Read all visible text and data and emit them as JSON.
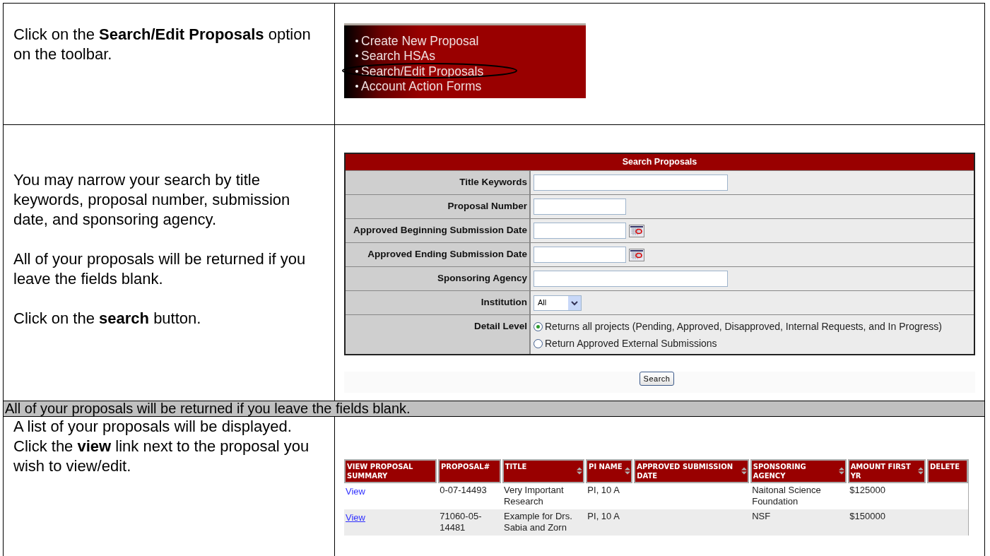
{
  "rows": [
    {
      "kind": "step",
      "paragraphs": [
        "Click on the **Search/Edit Proposals** option on the toolbar."
      ],
      "panel": {
        "kind": "menu",
        "items": [
          {
            "label": "Create New Proposal",
            "circled": false
          },
          {
            "label": "Search HSAs",
            "circled": false
          },
          {
            "label": "Search/Edit Proposals",
            "circled": true
          },
          {
            "label": "Account Action Forms",
            "circled": false
          }
        ]
      }
    },
    {
      "kind": "step",
      "paragraphs": [
        "You may narrow your search by title keywords, proposal number, submission date, and sponsoring agency.",
        "All of your proposals will be returned if you leave the fields blank.",
        "Click on the **search** button."
      ],
      "panel": {
        "kind": "search_form",
        "title": "Search Proposals",
        "fields": [
          {
            "kind": "long_text",
            "label": "Title Keywords"
          },
          {
            "kind": "short_text",
            "label": "Proposal Number"
          },
          {
            "kind": "date",
            "label": "Approved Beginning Submission Date"
          },
          {
            "kind": "date",
            "label": "Approved Ending Submission Date"
          },
          {
            "kind": "long_text",
            "label": "Sponsoring Agency"
          },
          {
            "kind": "select",
            "label": "Institution",
            "value": "All"
          },
          {
            "kind": "radio",
            "label": "Detail Level",
            "options": [
              {
                "label": "Returns all projects (Pending, Approved, Disapproved, Internal Requests, and In Progress)",
                "selected": true
              },
              {
                "label": "Return Approved External Submissions",
                "selected": false
              }
            ]
          }
        ],
        "button": "Search"
      }
    },
    {
      "kind": "note",
      "text": "All of your proposals will be returned if you leave the fields blank."
    },
    {
      "kind": "step",
      "paragraphs": [
        "A list of your proposals will be displayed.  Click the **view** link next to the proposal you wish to view/edit."
      ],
      "panel": {
        "kind": "results",
        "columns": [
          {
            "label": "VIEW PROPOSAL SUMMARY",
            "sortable": false
          },
          {
            "label": "PROPOSAL#",
            "sortable": false
          },
          {
            "label": "TITLE",
            "sortable": true
          },
          {
            "label": "PI NAME",
            "sortable": true
          },
          {
            "label": "APPROVED SUBMISSION DATE",
            "sortable": true
          },
          {
            "label": "SPONSORING AGENCY",
            "sortable": true
          },
          {
            "label": "AMOUNT FIRST YR",
            "sortable": true
          },
          {
            "label": "DELETE",
            "sortable": false
          }
        ],
        "rows": [
          {
            "underlined": false,
            "cells": [
              "View",
              "0-07-14493",
              "Very Important Research",
              "PI, 10 A",
              "",
              "Naitonal Science Foundation",
              "$125000",
              ""
            ]
          },
          {
            "underlined": true,
            "cells": [
              "View",
              "71060-05-14481",
              "Example for Drs. Sabia and Zorn",
              "PI, 10 A",
              "",
              "NSF",
              "$150000",
              ""
            ]
          }
        ]
      }
    }
  ]
}
